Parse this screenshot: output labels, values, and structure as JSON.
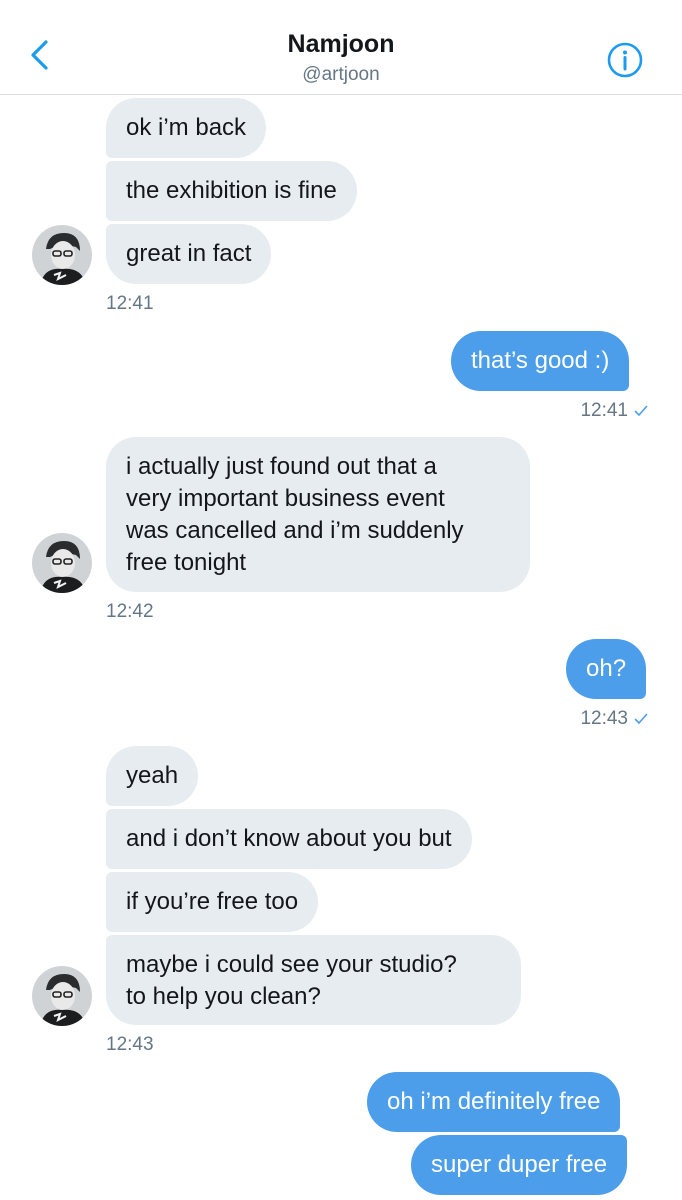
{
  "header": {
    "name": "Namjoon",
    "handle": "@artjoon",
    "back_icon": "chevron-left-icon",
    "info_icon": "info-icon",
    "accent_color": "#1d9bf0"
  },
  "colors": {
    "incoming_bubble": "#e6ecf0",
    "outgoing_bubble": "#4c9eeb",
    "timestamp": "#657786"
  },
  "messages": [
    {
      "id": "m1",
      "side": "in",
      "text": "ok i’m back"
    },
    {
      "id": "m2",
      "side": "in",
      "text": "the exhibition is fine"
    },
    {
      "id": "m3",
      "side": "in",
      "text": "great in fact"
    },
    {
      "id": "t1",
      "side": "in",
      "time": "12:41"
    },
    {
      "id": "m4",
      "side": "out",
      "text": "that’s good :)"
    },
    {
      "id": "t2",
      "side": "out",
      "time": "12:41",
      "read": true
    },
    {
      "id": "m5",
      "side": "in",
      "lines": [
        "i actually just found out that a",
        "very important business event",
        "was cancelled and i’m suddenly",
        "free tonight"
      ]
    },
    {
      "id": "t3",
      "side": "in",
      "time": "12:42"
    },
    {
      "id": "m6",
      "side": "out",
      "text": "oh?"
    },
    {
      "id": "t4",
      "side": "out",
      "time": "12:43",
      "read": true
    },
    {
      "id": "m7",
      "side": "in",
      "text": "yeah"
    },
    {
      "id": "m8",
      "side": "in",
      "text": "and i don’t know about you but"
    },
    {
      "id": "m9",
      "side": "in",
      "text": "if you’re free too"
    },
    {
      "id": "m10",
      "side": "in",
      "lines": [
        "maybe i could see your studio?",
        "to help you clean?"
      ]
    },
    {
      "id": "t5",
      "side": "in",
      "time": "12:43"
    },
    {
      "id": "m11",
      "side": "out",
      "text": "oh i’m definitely free"
    },
    {
      "id": "m12",
      "side": "out",
      "text": "super duper free"
    }
  ]
}
